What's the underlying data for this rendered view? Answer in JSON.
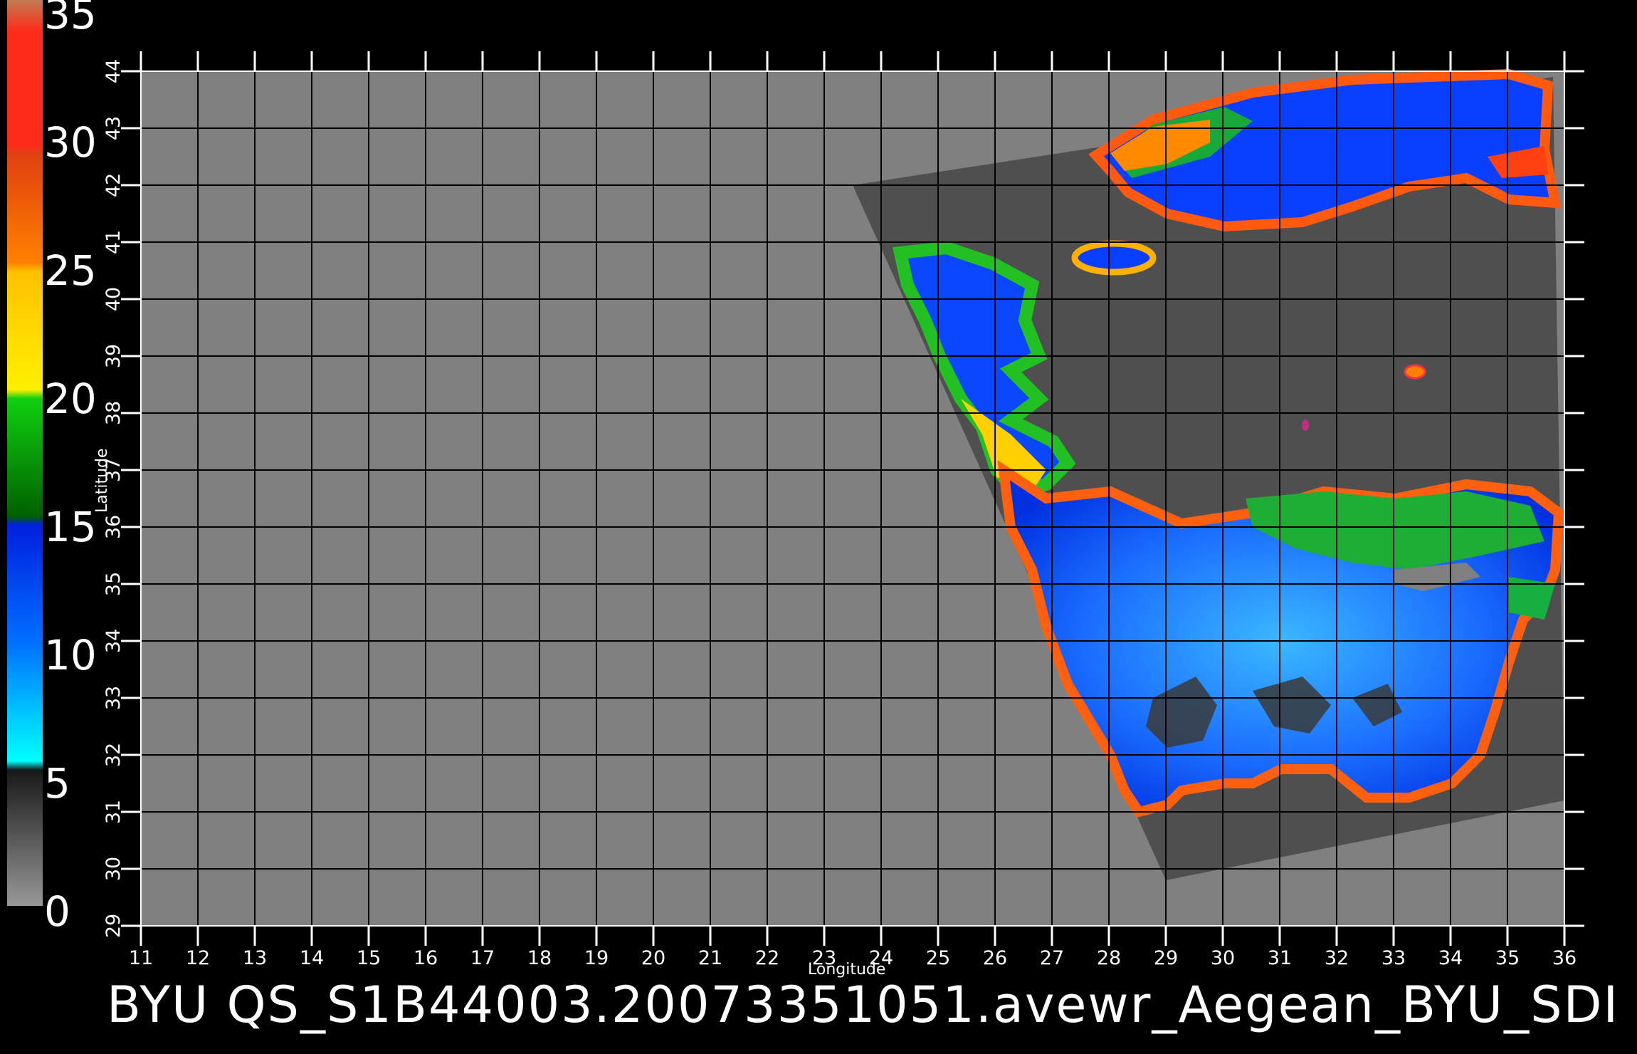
{
  "footer_text": "BYU QS_S1B44003.20073351051.avewr_Aegean_BYU_SDI",
  "colorbar": {
    "labels": [
      "35",
      "30",
      "25",
      "20",
      "15",
      "10",
      "5",
      "0"
    ],
    "stops": [
      {
        "color": "#c07a50"
      },
      {
        "color": "#ff2a1a"
      },
      {
        "color": "#e06018"
      },
      {
        "color": "#ffe000"
      },
      {
        "color": "#00c000"
      },
      {
        "color": "#0050ff"
      },
      {
        "color": "#00f0ff"
      },
      {
        "color": "#303030"
      },
      {
        "color": "#909090"
      }
    ]
  },
  "map": {
    "x_axis_label": "Longitude",
    "y_axis_label": "Latitude",
    "lon_ticks": [
      "11",
      "12",
      "13",
      "14",
      "15",
      "16",
      "17",
      "18",
      "19",
      "20",
      "21",
      "22",
      "23",
      "24",
      "25",
      "26",
      "27",
      "28",
      "29",
      "30",
      "31",
      "32",
      "33",
      "34",
      "35",
      "36"
    ],
    "lat_ticks": [
      "29",
      "30",
      "31",
      "32",
      "33",
      "34",
      "35",
      "36",
      "37",
      "38",
      "39",
      "40",
      "41",
      "42",
      "43",
      "44"
    ],
    "lon_range": [
      11,
      36
    ],
    "lat_range": [
      29,
      44
    ],
    "background_color": "#808080",
    "swath_color": "#4f4f4f",
    "swath_corners": [
      [
        23.5,
        42.0
      ],
      [
        35.8,
        43.9
      ],
      [
        36.0,
        31.2
      ],
      [
        29.0,
        29.8
      ]
    ]
  }
}
